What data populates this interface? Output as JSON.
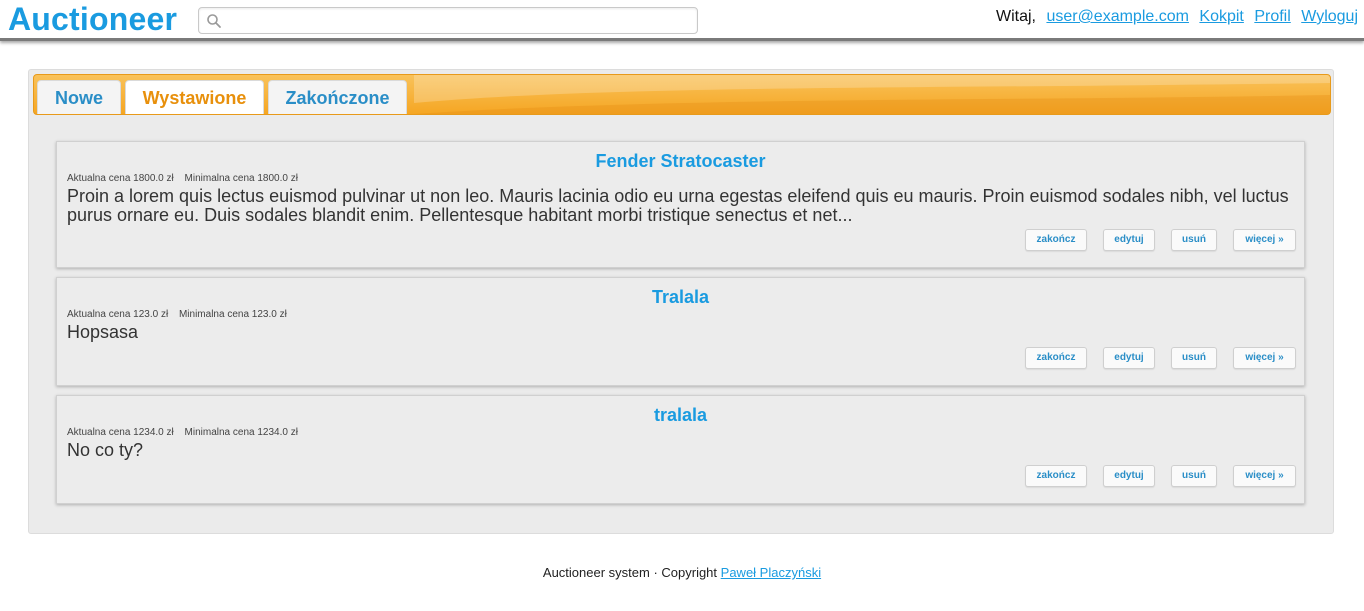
{
  "header": {
    "brand": "Auctioneer",
    "search": {
      "value": "",
      "placeholder": ""
    },
    "greeting": "Witaj,",
    "user_email": "user@example.com",
    "links": [
      "Kokpit",
      "Profil",
      "Wyloguj"
    ]
  },
  "tabs": [
    {
      "label": "Nowe",
      "active": false
    },
    {
      "label": "Wystawione",
      "active": true
    },
    {
      "label": "Zakończone",
      "active": false
    }
  ],
  "items": [
    {
      "title": "Fender Stratocaster",
      "current_price": "Aktualna cena 1800.0 zł",
      "min_price": "Minimalna cena 1800.0 zł",
      "description": "Proin a lorem quis lectus euismod pulvinar ut non leo. Mauris lacinia odio eu urna egestas eleifend quis eu mauris. Proin euismod sodales nibh, vel luctus purus ornare eu. Duis sodales blandit enim. Pellentesque habitant morbi tristique senectus et net..."
    },
    {
      "title": "Tralala",
      "current_price": "Aktualna cena 123.0 zł",
      "min_price": "Minimalna cena 123.0 zł",
      "description": "Hopsasa"
    },
    {
      "title": "tralala",
      "current_price": "Aktualna cena 1234.0 zł",
      "min_price": "Minimalna cena 1234.0 zł",
      "description": "No co ty?"
    }
  ],
  "item_actions": [
    "zakończ",
    "edytuj",
    "usuń",
    "więcej »"
  ],
  "footer": {
    "text": "Auctioneer system · Copyright",
    "author": "Paweł Placzyński"
  },
  "colors": {
    "brand": "#1a9be0",
    "tab_bar": "#f5a623",
    "active_tab_text": "#e8900c",
    "link": "#1a9be0"
  },
  "icons": {
    "search": "search-icon"
  }
}
